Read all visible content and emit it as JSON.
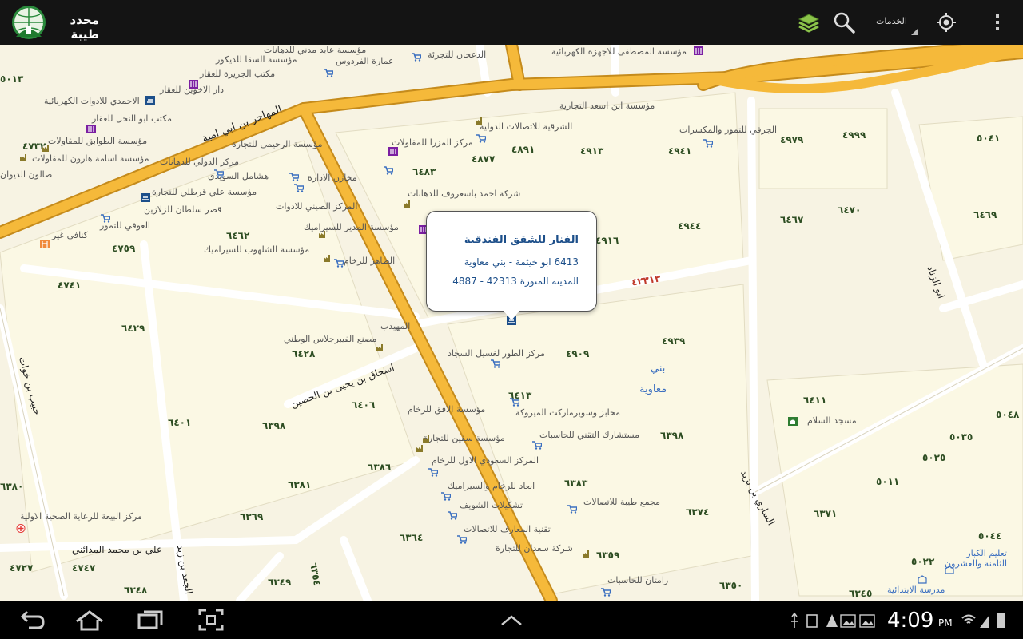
{
  "app": {
    "title": "محدد طيبة"
  },
  "toolbar": {
    "services_label": "الخدمات",
    "layers_icon": "layers-icon",
    "search_icon": "search-icon",
    "locate_icon": "gps-locate-icon",
    "overflow_icon": "overflow-menu-icon"
  },
  "popup": {
    "title": "الفنار للشقق الفندقية",
    "line1": "6413 ابو خيثمة - بني معاوية",
    "line2": "المدينة المنورة 42313 - 4887"
  },
  "streets": {
    "s1": "المهاجر بن ابي امية",
    "s2": "اسحاق بن يحيى بن الحصين",
    "s3": "ابو الزناد",
    "s4": "الساري بن يزيد",
    "s5": "علي بن محمد المدائني",
    "s6": "الجعد بن زيد",
    "s7": "حبيب بن خوات",
    "s8": "المهيدب",
    "s9": "٤٢٣١٣"
  },
  "district": {
    "line1": "بني",
    "line2": "معاوية"
  },
  "places": [
    "مؤسسة عابد مدني للدهانات",
    "مؤسسة السقا للديكور",
    "عمارة الفردوس",
    "الدعجان للتجزئة",
    "مؤسسة المصطفى للاجهزة الكهربائية",
    "مكتب الجزيرة للعقار",
    "دار الاخوين للعقار",
    "الاحمدي للادوات الكهربائية",
    "مكتب ابو النحل للعقار",
    "مؤسسة ابن اسعد التجارية",
    "الشرقية للاتصالات الدولية",
    "الجرفي للتمور والمكسرات",
    "مؤسسة الطوابق للمقاولات",
    "مؤسسة اسامة هارون للمقاولات",
    "صالون الديوان",
    "مؤسسة الرحيمي للتجارة",
    "مركز المزرا للمقاولات",
    "مركز الدولي للدهانات",
    "هشامل السويدي",
    "مخازن الادارة",
    "شركة احمد باسعروف للدهانات",
    "مؤسسة علي قرطلي للتجارة",
    "قصر سلطان للزلازين",
    "المركز الصيني للادوات",
    "العوفي للتمور",
    "مؤسسة المدير للسيراميك",
    "كنافي غير",
    "مؤسسة الشلهوب للسيراميك",
    "الطاهر للرخام",
    "المهيدب",
    "مصنع الفيبرجلاس الوطني",
    "مركز الطور لغسيل السجاد",
    "مخابز وسوبرماركت الميروكة",
    "مؤسسة الافق للرخام",
    "مؤسسة سفين للتجارة",
    "مستشارك التقني للحاسبات",
    "المركز السعودي الاول للرخام",
    "ابعاد للرخام والسيراميك",
    "تشكيلات الشويف",
    "مجمع طيبة للاتصالات",
    "مركز البيعة للرعاية الصحية الاولية",
    "تقنية المعارف للاتصالات",
    "شركة سعدان للتجارة",
    "رامتان للحاسبات",
    "مسجد السلام",
    "تعليم الكبار الثامنة والعشرون",
    "مدرسة الابتدائية"
  ],
  "parcels": [
    "٥٠١٣",
    "٤٧٣٢",
    "٦٤٦٢",
    "٤٧٥٩",
    "٤٧٤١",
    "٦٤٢٩",
    "٦٤٢٨",
    "٦٤٠١",
    "٦٤٠٦",
    "٦٣٩٨",
    "٦٣٨١",
    "٦٣٨٦",
    "٦٣٦٩",
    "٦٣٦٤",
    "٦٣٥٤",
    "٦٣٤٩",
    "٤٧٢٧",
    "٤٧٤٧",
    "٦٣٤٨",
    "٤٨٩١",
    "٤٨٧٧",
    "٦٤٨٣",
    "٤٩١٣",
    "٤٩٤١",
    "٤٩٧٩",
    "٤٩٩٩",
    "٥٠٤١",
    "٦٤٦٧",
    "٦٤٧٠",
    "٦٤٦٩",
    "٤٩٤٤",
    "٤٩١٦",
    "٤٩٣٩",
    "٤٩٠٩",
    "٦٤١٣",
    "٦٣٩٨",
    "٦٣٨٣",
    "٦٣٧٤",
    "٦٣٥٩",
    "٦٣٥٠",
    "٦٤١١",
    "٥٠٤٨",
    "٥٠٣٥",
    "٥٠٢٥",
    "٥٠١١",
    "٦٣٧١",
    "٥٠٤٤",
    "٥٠٢٢",
    "٦٣٤٥",
    "٦٣٨٠"
  ],
  "status": {
    "time": "4:09",
    "ampm": "PM"
  },
  "colors": {
    "major_road": "#f5b93a",
    "road": "#ffffff",
    "map_bg": "#f7f3e3",
    "block": "#fbf8e4",
    "poi_cart": "#3b6fc0",
    "popup_text": "#1d4f8a"
  },
  "nav": {
    "back_icon": "back-icon",
    "home_icon": "home-icon",
    "recent_icon": "recent-apps-icon",
    "screenshot_icon": "screenshot-icon",
    "up_icon": "chevron-up-icon"
  }
}
